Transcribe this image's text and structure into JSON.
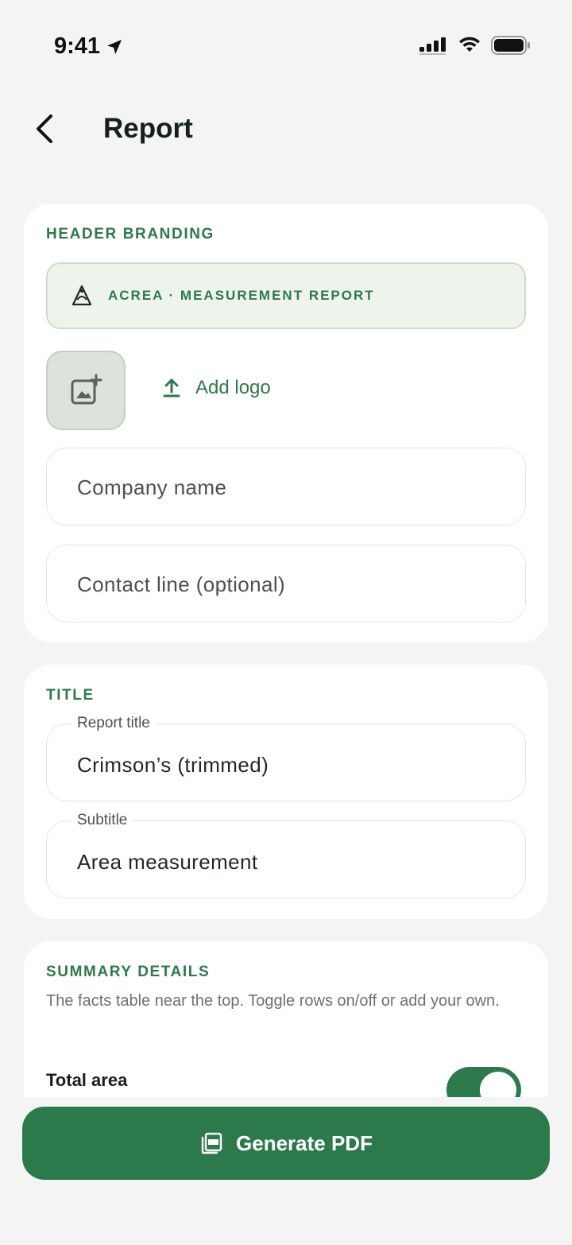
{
  "status_bar": {
    "time": "9:41"
  },
  "nav": {
    "title": "Report"
  },
  "header_branding": {
    "section_label": "HEADER BRANDING",
    "preview_text": "ACREA · MEASUREMENT REPORT",
    "add_logo_label": "Add logo",
    "company_name_placeholder": "Company name",
    "contact_line_placeholder": "Contact line (optional)"
  },
  "title_section": {
    "section_label": "TITLE",
    "report_title_label": "Report title",
    "report_title_value": "Crimson’s (trimmed)",
    "subtitle_label": "Subtitle",
    "subtitle_value": "Area measurement"
  },
  "summary_details": {
    "section_label": "SUMMARY DETAILS",
    "description": "The facts table near the top. Toggle rows on/off or add your own.",
    "rows": [
      {
        "label": "Total area",
        "enabled": true
      }
    ]
  },
  "actions": {
    "generate_label": "Generate PDF"
  },
  "colors": {
    "accent": "#2c7a4b",
    "background": "#f3f4f3",
    "card": "#ffffff",
    "branding_bg": "#eef4ec"
  },
  "icons": {
    "back": "chevron-left-icon",
    "location": "location-arrow-icon",
    "signal": "cellular-signal-icon",
    "wifi": "wifi-icon",
    "battery": "battery-icon",
    "brand": "acrea-logo-icon",
    "add_image": "add-image-icon",
    "upload": "upload-icon",
    "pdf": "pdf-icon"
  }
}
